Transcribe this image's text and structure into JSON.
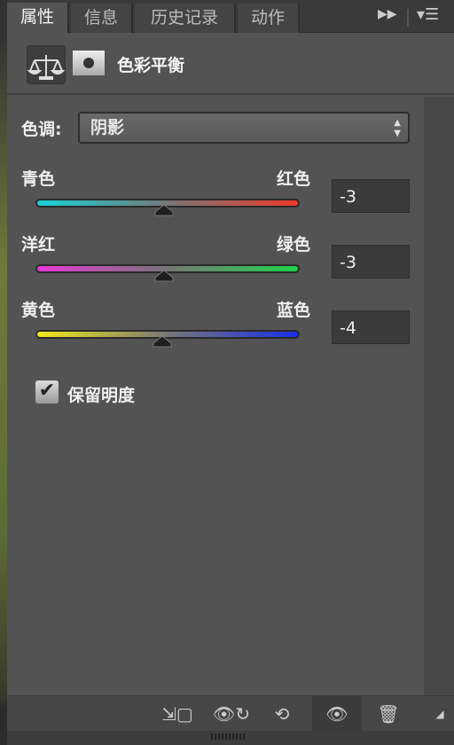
{
  "tabs": [
    {
      "label": "属性"
    },
    {
      "label": "信息"
    },
    {
      "label": "历史记录"
    },
    {
      "label": "动作"
    }
  ],
  "header": {
    "title": "色彩平衡",
    "adjustment_icon": "balance-scale-icon",
    "mask_icon": "layer-mask-icon"
  },
  "tone": {
    "label": "色调:",
    "value": "阴影"
  },
  "sliders": [
    {
      "left": "青色",
      "right": "红色",
      "value": "-3",
      "num": -3,
      "min": -100,
      "max": 100,
      "colors": [
        "#17d3d8",
        "#ee3a2a"
      ]
    },
    {
      "left": "洋红",
      "right": "绿色",
      "value": "-3",
      "num": -3,
      "min": -100,
      "max": 100,
      "colors": [
        "#e838d8",
        "#1ed44a"
      ]
    },
    {
      "left": "黄色",
      "right": "蓝色",
      "value": "-4",
      "num": -4,
      "min": -100,
      "max": 100,
      "colors": [
        "#f0e81a",
        "#1a2ee8"
      ]
    }
  ],
  "preserve_luminosity": {
    "label": "保留明度",
    "checked": true
  },
  "toolbar": [
    "clip-to-layer-icon",
    "view-previous-state-icon",
    "reset-icon",
    "visibility-eye-icon",
    "trash-icon"
  ]
}
